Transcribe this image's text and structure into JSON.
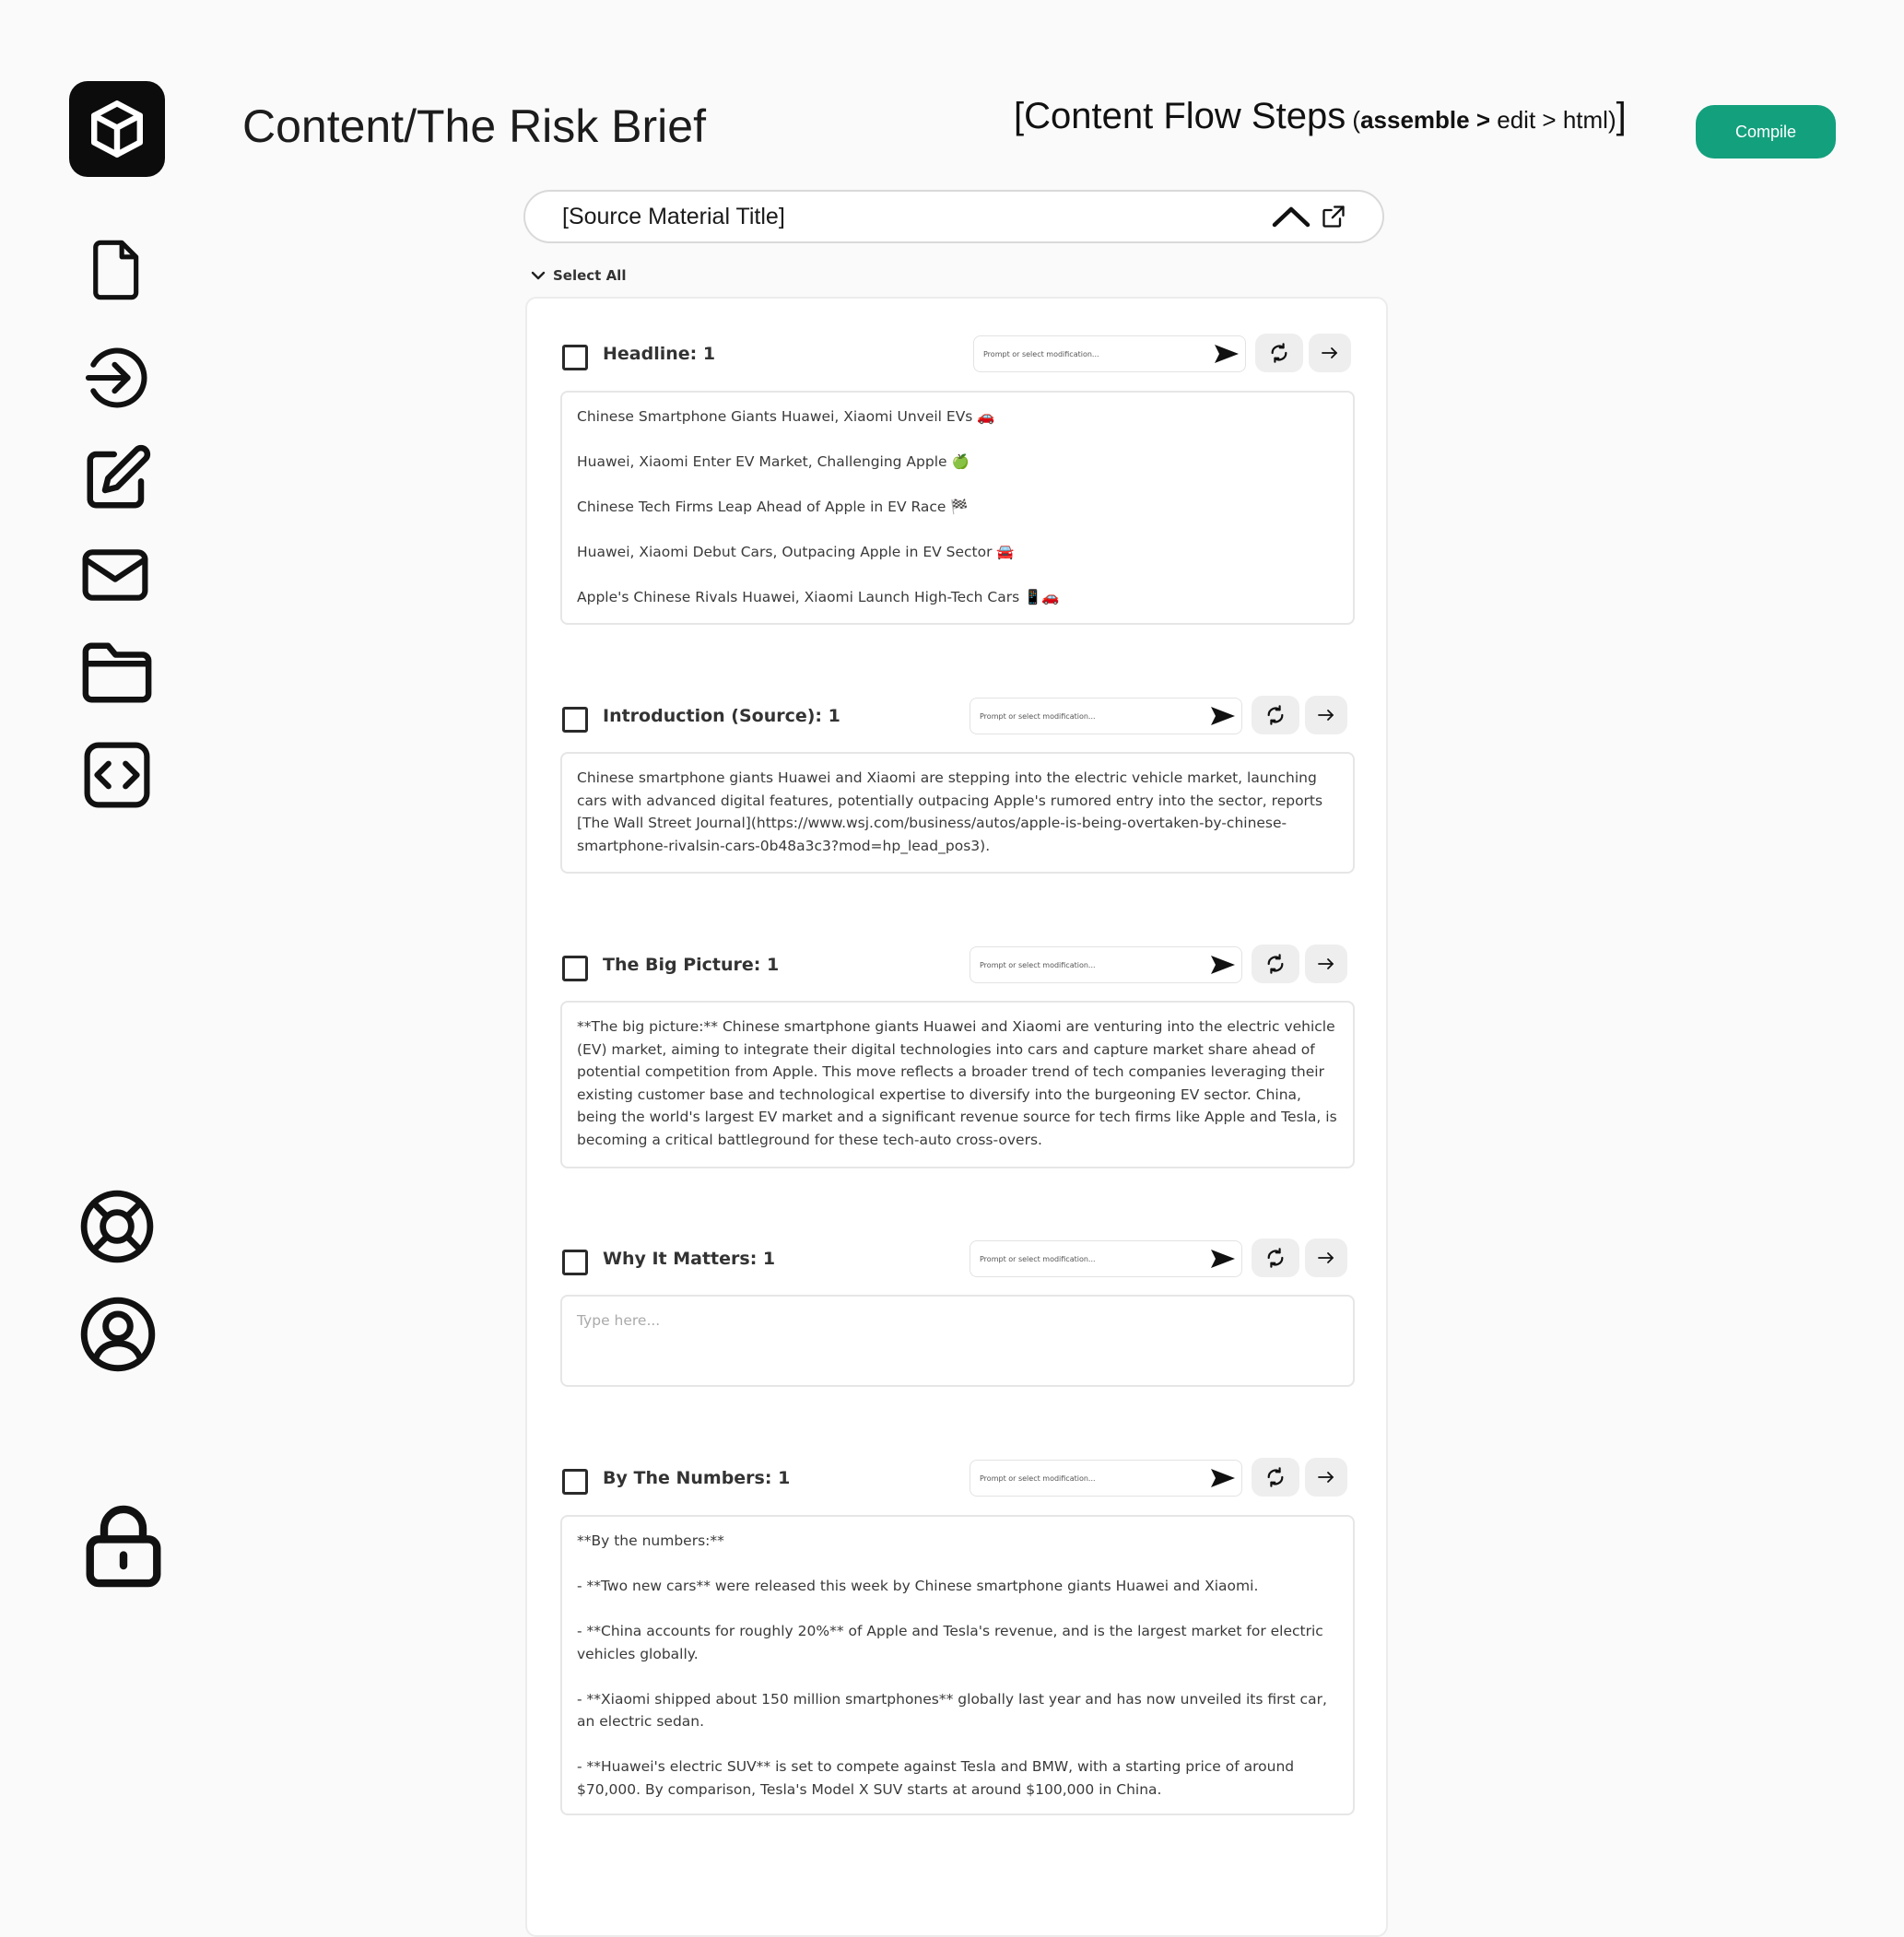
{
  "header": {
    "title": "Content/The Risk Brief",
    "flow_open": "[",
    "flow_label": "Content Flow Steps",
    "flow_paren_open": " (",
    "flow_step_1": "assemble",
    "flow_sep_1": " > ",
    "flow_step_2": "edit",
    "flow_sep_2": " > ",
    "flow_step_3": "html",
    "flow_paren_close": ")",
    "flow_close": "]",
    "compile_label": "Compile"
  },
  "source": {
    "title": "[Source Material Title]"
  },
  "select_all_label": "Select All",
  "prompt_placeholder": "Prompt or select modification...",
  "sections": [
    {
      "label": "Headline: 1",
      "lines": [
        "Chinese Smartphone Giants Huawei, Xiaomi Unveil EVs 🚗",
        "Huawei, Xiaomi Enter EV Market, Challenging Apple 🍏",
        "Chinese Tech Firms Leap Ahead of Apple in EV Race 🏁",
        "Huawei, Xiaomi Debut Cars, Outpacing Apple in EV Sector 🚘",
        "Apple's Chinese Rivals Huawei, Xiaomi Launch High-Tech Cars 📱🚗"
      ]
    },
    {
      "label": "Introduction (Source): 1",
      "text": "Chinese smartphone giants Huawei and Xiaomi are stepping into the electric vehicle market, launching cars with advanced digital features, potentially outpacing Apple's rumored entry into the sector, reports [The Wall Street Journal](https://www.wsj.com/business/autos/apple-is-being-overtaken-by-chinese-smartphone-rivalsin-cars-0b48a3c3?mod=hp_lead_pos3)."
    },
    {
      "label": "The Big Picture: 1",
      "text": "**The big picture:** Chinese smartphone giants Huawei and Xiaomi are venturing into the electric vehicle (EV) market, aiming to integrate their digital technologies into cars and capture market share ahead of potential competition from Apple. This move reflects a broader trend of tech companies leveraging their existing customer base and technological expertise to diversify into the burgeoning EV sector. China, being the world's largest EV market and a significant revenue source for tech firms like Apple and Tesla, is becoming a critical battleground for these tech-auto cross-overs."
    },
    {
      "label": "Why It Matters: 1",
      "placeholder": "Type here..."
    },
    {
      "label": "By The Numbers: 1",
      "lines": [
        "**By the numbers:**",
        "- **Two new cars** were released this week by Chinese smartphone giants Huawei and Xiaomi.",
        "- **China accounts for roughly 20%** of Apple and Tesla's revenue, and is the largest market for electric vehicles globally.",
        "- **Xiaomi shipped about 150 million smartphones** globally last year and has now unveiled its first car, an electric sedan.",
        "- **Huawei's electric SUV** is set to compete against Tesla and BMW, with a starting price of around $70,000. By comparison, Tesla's Model X SUV starts at around $100,000 in China."
      ]
    }
  ],
  "colors": {
    "accent": "#13a07d",
    "logo_bg": "#0c0c0c",
    "background": "#fafafa"
  },
  "icons": {
    "logo": "cube-icon",
    "sidebar": [
      "document-icon",
      "sign-in-icon",
      "edit-icon",
      "mail-icon",
      "folder-icon",
      "code-icon",
      "lifebuoy-icon",
      "user-circle-icon",
      "lock-icon"
    ]
  }
}
